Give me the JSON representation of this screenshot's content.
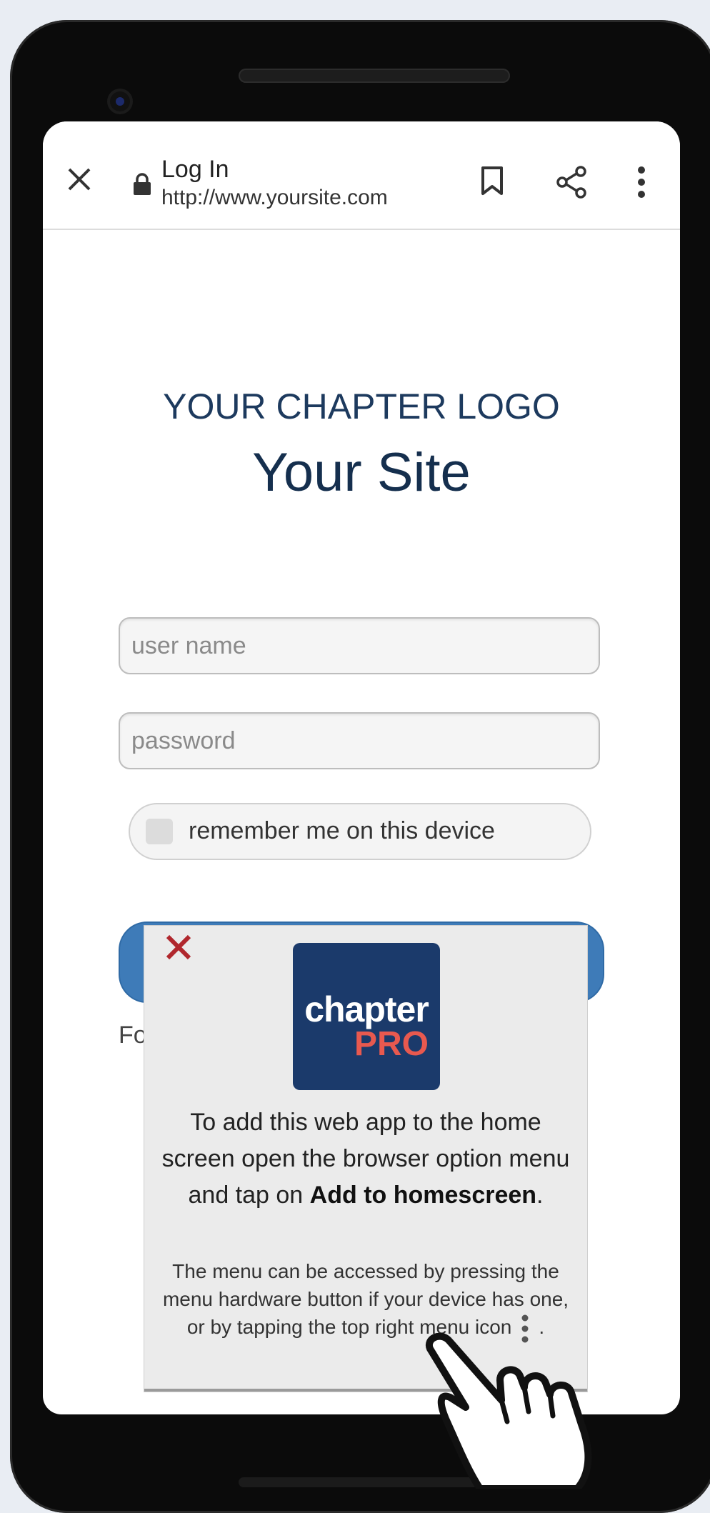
{
  "browser": {
    "page_title": "Log In",
    "url": "http://www.yoursite.com"
  },
  "site": {
    "logo_text": "YOUR CHAPTER LOGO",
    "title": "Your Site"
  },
  "login": {
    "username_placeholder": "user name",
    "password_placeholder": "password",
    "remember_label": "remember me on this device",
    "forgot_prefix": "Fo"
  },
  "popup": {
    "app_logo_line1": "chapter",
    "app_logo_line2": "PRO",
    "main_part1": "To add this web app to the home screen open the browser option menu and tap on ",
    "main_bold": "Add to homescreen",
    "main_part2": ".",
    "sub_text": "The menu can be accessed by pressing the menu hardware button if your device has one, or by tapping the top right menu icon",
    "sub_end": "."
  },
  "colors": {
    "brand_navy": "#1b3a6b",
    "brand_red": "#e8594f",
    "login_button": "#3e7bb8",
    "popup_close": "#b0272d"
  },
  "icons": [
    "close-icon",
    "lock-icon",
    "bookmark-icon",
    "share-icon",
    "more-vert-icon",
    "pointing-hand-icon"
  ]
}
